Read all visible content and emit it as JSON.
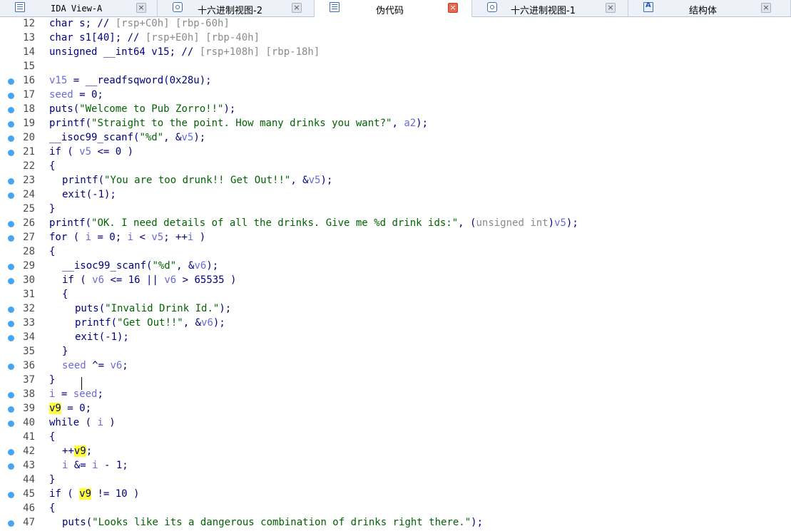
{
  "tabs": [
    {
      "label": "IDA View-A",
      "icon": "text-view-icon",
      "active": false
    },
    {
      "label": "十六进制视图-2",
      "icon": "hex-view-icon",
      "active": false
    },
    {
      "label": "伪代码",
      "icon": "pseudocode-icon",
      "active": true
    },
    {
      "label": "十六进制视图-1",
      "icon": "hex-view-icon",
      "active": false
    },
    {
      "label": "结构体",
      "icon": "structures-icon",
      "active": false
    }
  ],
  "close_glyph": "×",
  "colors": {
    "keyword": "#000080",
    "variable": "#6a6ad8",
    "comment": "#8a8a8a",
    "string": "#006400",
    "highlight": "#ffff33",
    "breakpoint": "#47a5f1"
  },
  "lines": [
    {
      "num": "12",
      "bp": false,
      "indent": 0,
      "segs": [
        [
          "t",
          "char s; // "
        ],
        [
          "c",
          "[rsp+C0h] [rbp-60h]"
        ]
      ]
    },
    {
      "num": "13",
      "bp": false,
      "indent": 0,
      "segs": [
        [
          "t",
          "char s1[40]; // "
        ],
        [
          "c",
          "[rsp+E0h] [rbp-40h]"
        ]
      ]
    },
    {
      "num": "14",
      "bp": false,
      "indent": 0,
      "segs": [
        [
          "t",
          "unsigned __int64 v15; // "
        ],
        [
          "c",
          "[rsp+108h] [rbp-18h]"
        ]
      ]
    },
    {
      "num": "15",
      "bp": false,
      "indent": 0,
      "segs": []
    },
    {
      "num": "16",
      "bp": true,
      "indent": 0,
      "segs": [
        [
          "v",
          "v15"
        ],
        [
          "t",
          " = __readfsqword(0x28u);"
        ]
      ]
    },
    {
      "num": "17",
      "bp": true,
      "indent": 0,
      "segs": [
        [
          "v",
          "seed"
        ],
        [
          "t",
          " = 0;"
        ]
      ]
    },
    {
      "num": "18",
      "bp": true,
      "indent": 0,
      "segs": [
        [
          "t",
          "puts("
        ],
        [
          "s",
          "\"Welcome to Pub Zorro!!\""
        ],
        [
          "t",
          ");"
        ]
      ]
    },
    {
      "num": "19",
      "bp": true,
      "indent": 0,
      "segs": [
        [
          "t",
          "printf("
        ],
        [
          "s",
          "\"Straight to the point. How many drinks you want?\""
        ],
        [
          "t",
          ", "
        ],
        [
          "v",
          "a2"
        ],
        [
          "t",
          ");"
        ]
      ]
    },
    {
      "num": "20",
      "bp": true,
      "indent": 0,
      "segs": [
        [
          "t",
          "__isoc99_scanf("
        ],
        [
          "s",
          "\"%d\""
        ],
        [
          "t",
          ", &"
        ],
        [
          "v",
          "v5"
        ],
        [
          "t",
          ");"
        ]
      ]
    },
    {
      "num": "21",
      "bp": true,
      "indent": 0,
      "segs": [
        [
          "t",
          "if ( "
        ],
        [
          "v",
          "v5"
        ],
        [
          "t",
          " <= 0 )"
        ]
      ]
    },
    {
      "num": "22",
      "bp": false,
      "indent": 0,
      "segs": [
        [
          "t",
          "{"
        ]
      ]
    },
    {
      "num": "23",
      "bp": true,
      "indent": 1,
      "segs": [
        [
          "t",
          "printf("
        ],
        [
          "s",
          "\"You are too drunk!! Get Out!!\""
        ],
        [
          "t",
          ", &"
        ],
        [
          "v",
          "v5"
        ],
        [
          "t",
          ");"
        ]
      ]
    },
    {
      "num": "24",
      "bp": true,
      "indent": 1,
      "segs": [
        [
          "t",
          "exit(-1);"
        ]
      ]
    },
    {
      "num": "25",
      "bp": false,
      "indent": 0,
      "segs": [
        [
          "t",
          "}"
        ]
      ]
    },
    {
      "num": "26",
      "bp": true,
      "indent": 0,
      "segs": [
        [
          "t",
          "printf("
        ],
        [
          "s",
          "\"OK. I need details of all the drinks. Give me %d drink ids:\""
        ],
        [
          "t",
          ", ("
        ],
        [
          "c",
          "unsigned int"
        ],
        [
          "t",
          ")"
        ],
        [
          "v",
          "v5"
        ],
        [
          "t",
          ");"
        ]
      ]
    },
    {
      "num": "27",
      "bp": true,
      "indent": 0,
      "segs": [
        [
          "t",
          "for ( "
        ],
        [
          "v",
          "i"
        ],
        [
          "t",
          " = 0; "
        ],
        [
          "v",
          "i"
        ],
        [
          "t",
          " < "
        ],
        [
          "v",
          "v5"
        ],
        [
          "t",
          "; ++"
        ],
        [
          "v",
          "i"
        ],
        [
          "t",
          " )"
        ]
      ]
    },
    {
      "num": "28",
      "bp": false,
      "indent": 0,
      "segs": [
        [
          "t",
          "{"
        ]
      ]
    },
    {
      "num": "29",
      "bp": true,
      "indent": 1,
      "segs": [
        [
          "t",
          "__isoc99_scanf("
        ],
        [
          "s",
          "\"%d\""
        ],
        [
          "t",
          ", &"
        ],
        [
          "v",
          "v6"
        ],
        [
          "t",
          ");"
        ]
      ]
    },
    {
      "num": "30",
      "bp": true,
      "indent": 1,
      "segs": [
        [
          "t",
          "if ( "
        ],
        [
          "v",
          "v6"
        ],
        [
          "t",
          " <= 16 || "
        ],
        [
          "v",
          "v6"
        ],
        [
          "t",
          " > 65535 )"
        ]
      ]
    },
    {
      "num": "31",
      "bp": false,
      "indent": 1,
      "segs": [
        [
          "t",
          "{"
        ]
      ]
    },
    {
      "num": "32",
      "bp": true,
      "indent": 2,
      "segs": [
        [
          "t",
          "puts("
        ],
        [
          "s",
          "\"Invalid Drink Id.\""
        ],
        [
          "t",
          ");"
        ]
      ]
    },
    {
      "num": "33",
      "bp": true,
      "indent": 2,
      "segs": [
        [
          "t",
          "printf("
        ],
        [
          "s",
          "\"Get Out!!\""
        ],
        [
          "t",
          ", &"
        ],
        [
          "v",
          "v6"
        ],
        [
          "t",
          ");"
        ]
      ]
    },
    {
      "num": "34",
      "bp": true,
      "indent": 2,
      "segs": [
        [
          "t",
          "exit(-1);"
        ]
      ]
    },
    {
      "num": "35",
      "bp": false,
      "indent": 1,
      "segs": [
        [
          "t",
          "}"
        ]
      ]
    },
    {
      "num": "36",
      "bp": true,
      "indent": 1,
      "segs": [
        [
          "v",
          "seed"
        ],
        [
          "t",
          " ^= "
        ],
        [
          "v",
          "v6"
        ],
        [
          "t",
          ";"
        ]
      ]
    },
    {
      "num": "37",
      "bp": false,
      "indent": 0,
      "segs": [
        [
          "t",
          "}"
        ]
      ]
    },
    {
      "num": "38",
      "bp": true,
      "indent": 0,
      "segs": [
        [
          "v",
          "i"
        ],
        [
          "t",
          " = "
        ],
        [
          "v",
          "seed"
        ],
        [
          "t",
          ";"
        ]
      ]
    },
    {
      "num": "39",
      "bp": true,
      "indent": 0,
      "segs": [
        [
          "h",
          "v9"
        ],
        [
          "t",
          " = 0;"
        ]
      ]
    },
    {
      "num": "40",
      "bp": true,
      "indent": 0,
      "segs": [
        [
          "t",
          "while ( "
        ],
        [
          "v",
          "i"
        ],
        [
          "t",
          " )"
        ]
      ]
    },
    {
      "num": "41",
      "bp": false,
      "indent": 0,
      "segs": [
        [
          "t",
          "{"
        ]
      ]
    },
    {
      "num": "42",
      "bp": true,
      "indent": 1,
      "segs": [
        [
          "t",
          "++"
        ],
        [
          "h",
          "v9"
        ],
        [
          "t",
          ";"
        ]
      ]
    },
    {
      "num": "43",
      "bp": true,
      "indent": 1,
      "segs": [
        [
          "v",
          "i"
        ],
        [
          "t",
          " &= "
        ],
        [
          "v",
          "i"
        ],
        [
          "t",
          " - 1;"
        ]
      ]
    },
    {
      "num": "44",
      "bp": false,
      "indent": 0,
      "segs": [
        [
          "t",
          "}"
        ]
      ]
    },
    {
      "num": "45",
      "bp": true,
      "indent": 0,
      "segs": [
        [
          "t",
          "if ( "
        ],
        [
          "h",
          "v9"
        ],
        [
          "t",
          " != 10 )"
        ]
      ]
    },
    {
      "num": "46",
      "bp": false,
      "indent": 0,
      "segs": [
        [
          "t",
          "{"
        ]
      ]
    },
    {
      "num": "47",
      "bp": true,
      "indent": 1,
      "segs": [
        [
          "t",
          "puts("
        ],
        [
          "s",
          "\"Looks like its a dangerous combination of drinks right there.\""
        ],
        [
          "t",
          ");"
        ]
      ]
    }
  ]
}
